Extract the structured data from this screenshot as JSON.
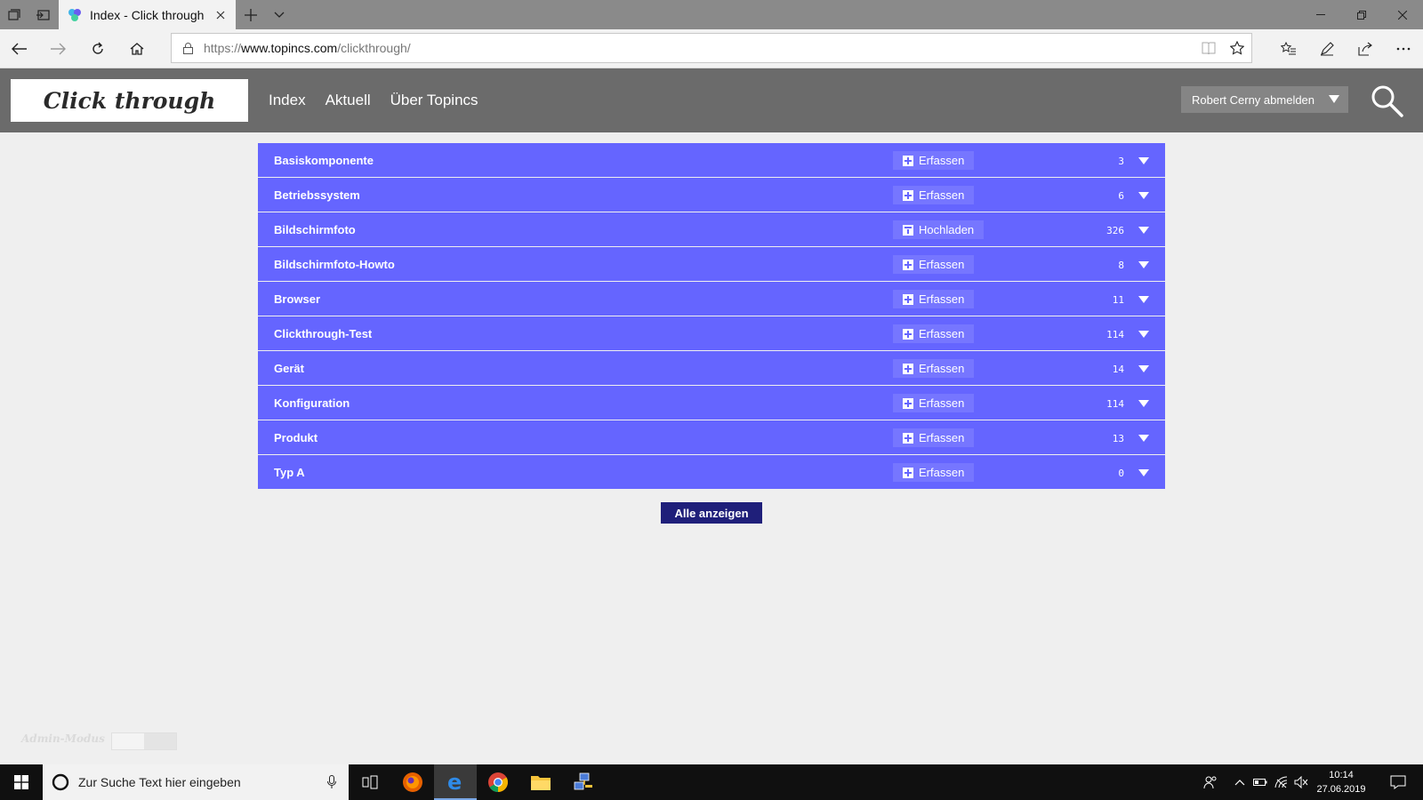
{
  "browser": {
    "tab_title": "Index - Click through",
    "url_prefix": "https://",
    "url_host": "www.topincs.com",
    "url_path": "/clickthrough/"
  },
  "site": {
    "logo_text": "Click through",
    "nav": [
      "Index",
      "Aktuell",
      "Über Topincs"
    ],
    "user_menu_label": "Robert Cerny abmelden"
  },
  "list": [
    {
      "name": "Basiskomponente",
      "action": "Erfassen",
      "action_icon": "plus-square-icon",
      "count": "3"
    },
    {
      "name": "Betriebssystem",
      "action": "Erfassen",
      "action_icon": "plus-square-icon",
      "count": "6"
    },
    {
      "name": "Bildschirmfoto",
      "action": "Hochladen",
      "action_icon": "upload-icon",
      "count": "326"
    },
    {
      "name": "Bildschirmfoto-Howto",
      "action": "Erfassen",
      "action_icon": "plus-square-icon",
      "count": "8"
    },
    {
      "name": "Browser",
      "action": "Erfassen",
      "action_icon": "plus-square-icon",
      "count": "11"
    },
    {
      "name": "Clickthrough-Test",
      "action": "Erfassen",
      "action_icon": "plus-square-icon",
      "count": "114"
    },
    {
      "name": "Gerät",
      "action": "Erfassen",
      "action_icon": "plus-square-icon",
      "count": "14"
    },
    {
      "name": "Konfiguration",
      "action": "Erfassen",
      "action_icon": "plus-square-icon",
      "count": "114"
    },
    {
      "name": "Produkt",
      "action": "Erfassen",
      "action_icon": "plus-square-icon",
      "count": "13"
    },
    {
      "name": "Typ A",
      "action": "Erfassen",
      "action_icon": "plus-square-icon",
      "count": "0"
    }
  ],
  "show_all_label": "Alle anzeigen",
  "admin_mode_label": "Admin-Modus",
  "taskbar": {
    "search_placeholder": "Zur Suche Text hier eingeben",
    "time": "10:14",
    "date": "27.06.2019"
  },
  "colors": {
    "row_bg": "#6565ff",
    "header_bg": "#6b6b6b",
    "button_dark": "#1f1f7a"
  }
}
